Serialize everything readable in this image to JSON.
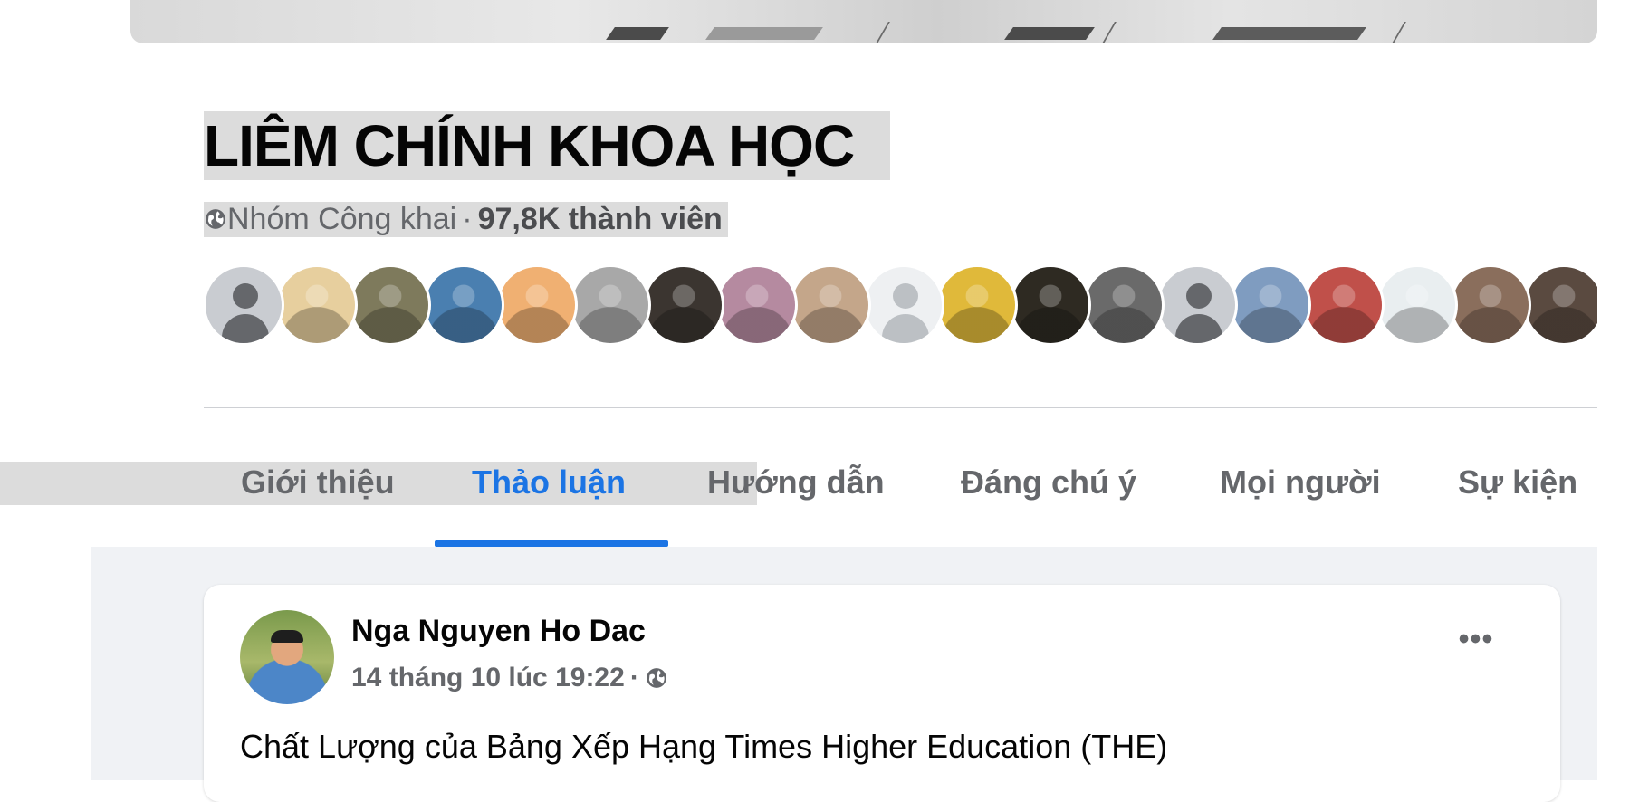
{
  "group": {
    "name": "LIÊM CHÍNH KHOA HỌC",
    "privacy": "Nhóm Công khai",
    "separator": "·",
    "members": "97,8K thành viên"
  },
  "member_avatars": [
    {
      "kind": "placeholder"
    },
    {
      "kind": "photo",
      "color": "#e7cf9e"
    },
    {
      "kind": "photo",
      "color": "#7e7a5c"
    },
    {
      "kind": "photo",
      "color": "#4a7fb0"
    },
    {
      "kind": "photo",
      "color": "#f0b072"
    },
    {
      "kind": "photo",
      "color": "#a8a8a8"
    },
    {
      "kind": "photo",
      "color": "#3b3530"
    },
    {
      "kind": "photo",
      "color": "#b58aa0"
    },
    {
      "kind": "photo",
      "color": "#c4a68a"
    },
    {
      "kind": "light-placeholder"
    },
    {
      "kind": "photo",
      "color": "#e0b93a"
    },
    {
      "kind": "photo",
      "color": "#2e2a22"
    },
    {
      "kind": "photo",
      "color": "#6a6a6a"
    },
    {
      "kind": "placeholder"
    },
    {
      "kind": "photo",
      "color": "#7f9cc0"
    },
    {
      "kind": "photo",
      "color": "#c0504a"
    },
    {
      "kind": "photo",
      "color": "#e9eef0"
    },
    {
      "kind": "photo",
      "color": "#8a6e5c"
    },
    {
      "kind": "photo",
      "color": "#5a4a40"
    }
  ],
  "tabs": [
    {
      "label": "Giới thiệu",
      "active": false
    },
    {
      "label": "Thảo luận",
      "active": true
    },
    {
      "label": "Hướng dẫn",
      "active": false
    },
    {
      "label": "Đáng chú ý",
      "active": false
    },
    {
      "label": "Mọi người",
      "active": false
    },
    {
      "label": "Sự kiện",
      "active": false
    }
  ],
  "post": {
    "author": "Nga Nguyen Ho Dac",
    "timestamp": "14 tháng 10 lúc 19:22",
    "separator": "·",
    "text": "Chất Lượng của Bảng Xếp Hạng Times Higher Education (THE)",
    "more_icon": "•••"
  },
  "colors": {
    "accent": "#1b74e4",
    "secondary_text": "#65676b",
    "feed_background": "#f0f2f5"
  }
}
